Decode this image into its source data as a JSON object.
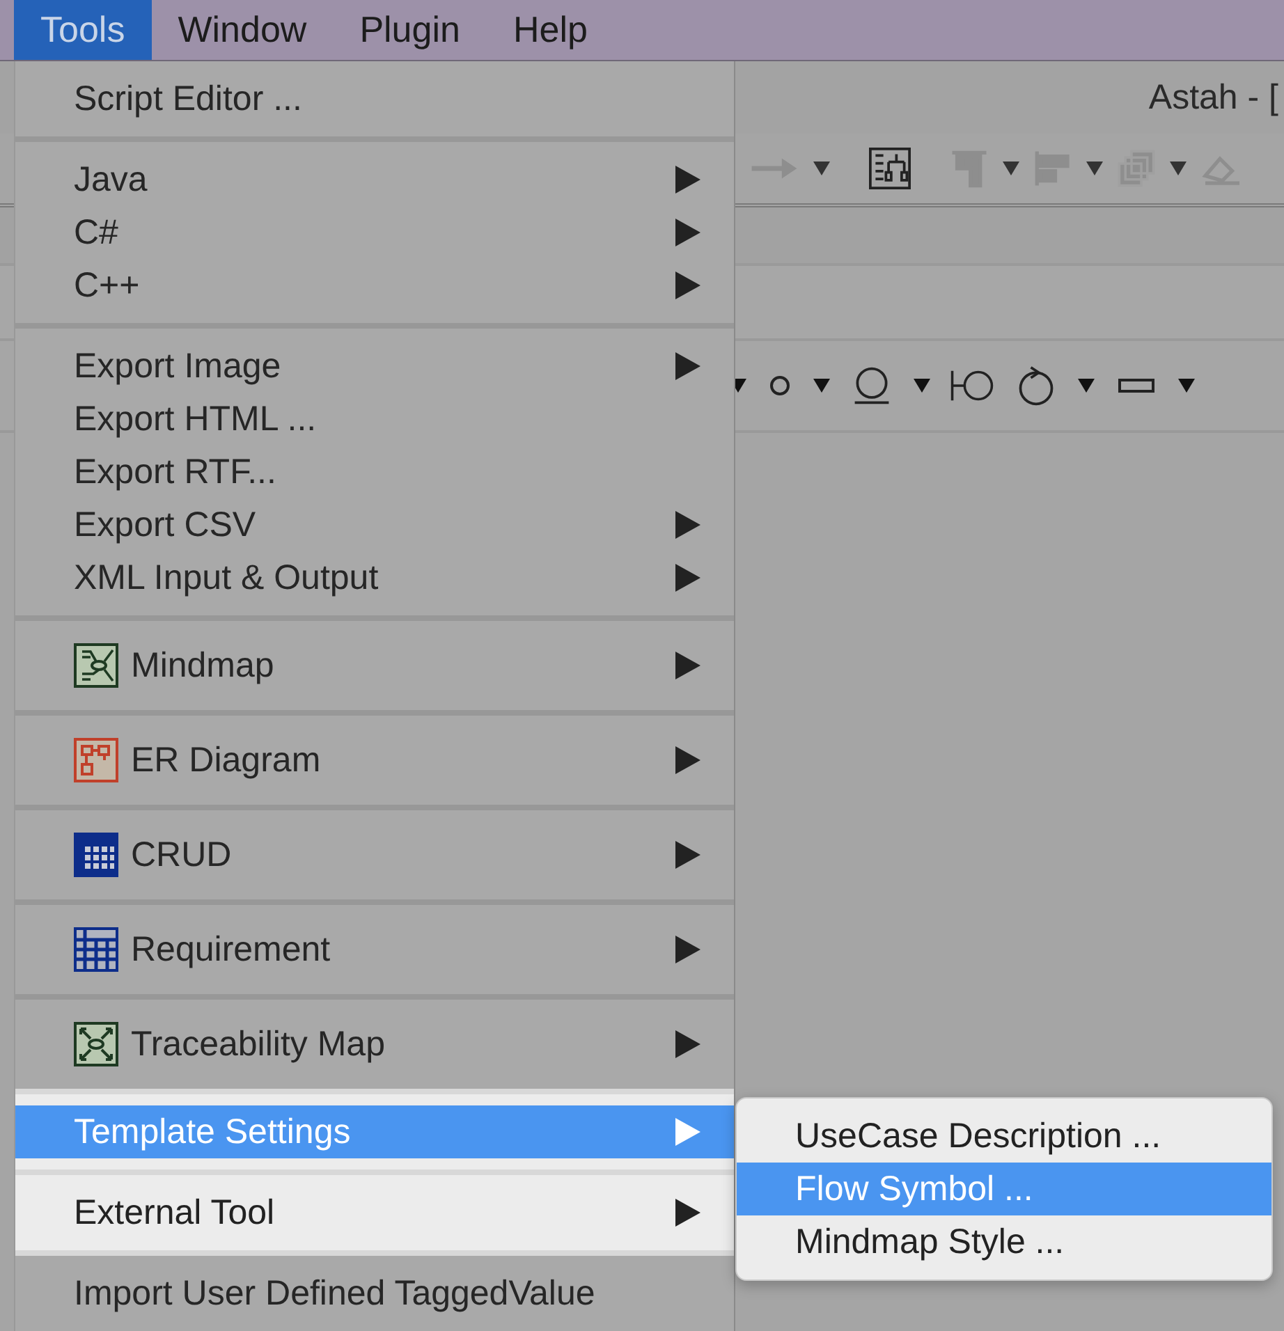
{
  "menubar": [
    {
      "label": "Tools",
      "selected": true
    },
    {
      "label": "Window",
      "selected": false
    },
    {
      "label": "Plugin",
      "selected": false
    },
    {
      "label": "Help",
      "selected": false
    }
  ],
  "window": {
    "title": "Astah - ["
  },
  "menu": {
    "groups": [
      {
        "items": [
          {
            "label": "Script Editor ...",
            "submenu": false,
            "selected": false,
            "spotlit": false
          }
        ]
      },
      {
        "items": [
          {
            "label": "Java",
            "submenu": true,
            "selected": false,
            "spotlit": false
          },
          {
            "label": "C#",
            "submenu": true,
            "selected": false,
            "spotlit": false
          },
          {
            "label": "C++",
            "submenu": true,
            "selected": false,
            "spotlit": false
          }
        ]
      },
      {
        "items": [
          {
            "label": "Export Image",
            "submenu": true,
            "selected": false,
            "spotlit": false
          },
          {
            "label": "Export HTML ...",
            "submenu": false,
            "selected": false,
            "spotlit": false
          },
          {
            "label": "Export RTF...",
            "submenu": false,
            "selected": false,
            "spotlit": false
          },
          {
            "label": "Export CSV",
            "submenu": true,
            "selected": false,
            "spotlit": false
          },
          {
            "label": "XML Input & Output",
            "submenu": true,
            "selected": false,
            "spotlit": false
          }
        ]
      },
      {
        "items": [
          {
            "label": "Mindmap",
            "kind": "mindmap",
            "submenu": true,
            "selected": false,
            "spotlit": false
          }
        ]
      },
      {
        "items": [
          {
            "label": "ER Diagram",
            "kind": "er",
            "submenu": true,
            "selected": false,
            "spotlit": false
          }
        ]
      },
      {
        "items": [
          {
            "label": "CRUD",
            "kind": "crud",
            "submenu": true,
            "selected": false,
            "spotlit": false
          }
        ]
      },
      {
        "items": [
          {
            "label": "Requirement",
            "kind": "requirement",
            "submenu": true,
            "selected": false,
            "spotlit": false
          }
        ]
      },
      {
        "items": [
          {
            "label": "Traceability Map",
            "kind": "traceability",
            "submenu": true,
            "selected": false,
            "spotlit": false
          }
        ]
      },
      {
        "items": [
          {
            "label": "Template Settings",
            "submenu": true,
            "selected": true,
            "spotlit": true
          }
        ]
      },
      {
        "items": [
          {
            "label": "External Tool",
            "submenu": true,
            "selected": false,
            "spotlit": true
          }
        ]
      },
      {
        "items": [
          {
            "label": "Import User Defined TaggedValue",
            "submenu": false,
            "selected": false,
            "spotlit": false
          }
        ]
      }
    ]
  },
  "submenu": {
    "items": [
      {
        "label": "UseCase Description ...",
        "selected": false
      },
      {
        "label": "Flow Symbol ...",
        "selected": true
      },
      {
        "label": "Mindmap Style ...",
        "selected": false
      }
    ]
  }
}
